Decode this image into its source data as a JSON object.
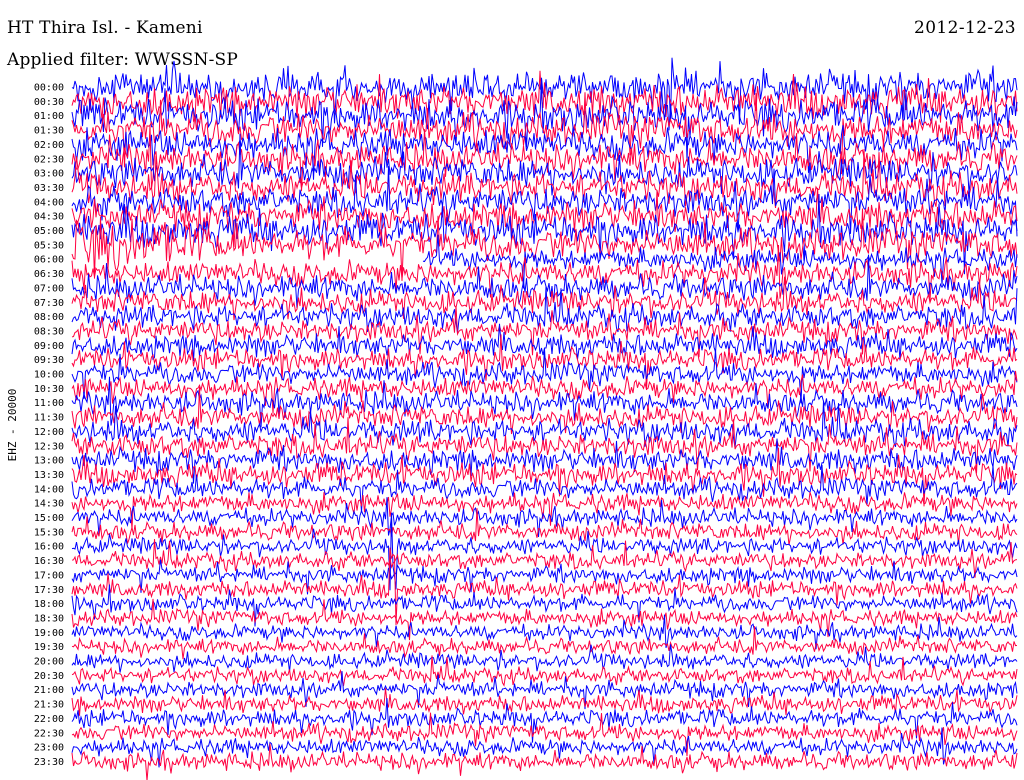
{
  "header": {
    "station_title": "HT Thira Isl. - Kameni",
    "date": "2012-12-23",
    "filter_label": "Applied filter: WWSSN-SP"
  },
  "channel_label": "EHZ - 20000",
  "colors": {
    "background": "#ffffff",
    "trace_blue": "#0000ff",
    "trace_red": "#ff0040",
    "text": "#000000"
  },
  "chart_data": {
    "type": "helicorder",
    "title": "HT Thira Isl. - Kameni",
    "date": "2012-12-23",
    "filter": "WWSSN-SP",
    "channel": "EHZ - 20000",
    "grid": false,
    "legend": "none",
    "row_interval_minutes": 30,
    "line_count": 48,
    "trace_colors_alternating": [
      "#0000ff",
      "#ff0040"
    ],
    "y_tick_labels": [
      "00:00",
      "00:30",
      "01:00",
      "01:30",
      "02:00",
      "02:30",
      "03:00",
      "03:30",
      "04:00",
      "04:30",
      "05:00",
      "05:30",
      "06:00",
      "06:30",
      "07:00",
      "07:30",
      "08:00",
      "08:30",
      "09:00",
      "09:30",
      "10:00",
      "10:30",
      "11:00",
      "11:30",
      "12:00",
      "12:30",
      "13:00",
      "13:30",
      "14:00",
      "14:30",
      "15:00",
      "15:30",
      "16:00",
      "16:30",
      "17:00",
      "17:30",
      "18:00",
      "18:30",
      "19:00",
      "19:30",
      "20:00",
      "20:30",
      "21:00",
      "21:30",
      "22:00",
      "22:30",
      "23:00",
      "23:30"
    ],
    "relative_amplitude": [
      1.35,
      1.35,
      1.35,
      1.35,
      1.25,
      1.25,
      1.25,
      1.25,
      1.25,
      1.25,
      1.3,
      1.3,
      0.9,
      1.05,
      1.05,
      1.0,
      1.0,
      0.95,
      0.95,
      0.9,
      0.9,
      0.9,
      0.95,
      0.95,
      1.0,
      1.0,
      0.95,
      0.95,
      0.85,
      0.8,
      0.75,
      0.75,
      0.7,
      0.7,
      0.7,
      0.7,
      0.68,
      0.68,
      0.65,
      0.65,
      0.65,
      0.65,
      0.7,
      0.7,
      0.72,
      0.72,
      0.72,
      0.75
    ],
    "events": [
      {
        "label_time": "06:00",
        "type": "data gap",
        "start_fraction": 0.0,
        "end_fraction": 0.37
      },
      {
        "label_time": "05:30",
        "type": "high amplitude",
        "start_fraction": 0.0,
        "end_fraction": 0.13
      },
      {
        "label_time": "16:00",
        "type": "spike",
        "at_fraction": 0.34
      },
      {
        "label_time": "17:30",
        "type": "spike",
        "at_fraction": 0.34
      }
    ]
  }
}
